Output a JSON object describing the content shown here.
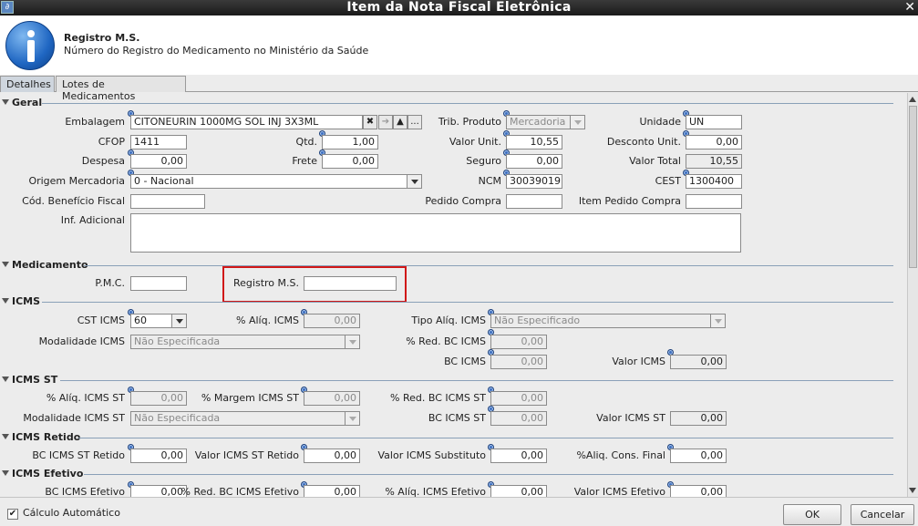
{
  "window": {
    "title": "Item da Nota Fiscal Eletrônica",
    "close_glyph": "✕",
    "app_icon_glyph": "∂"
  },
  "header": {
    "title": "Registro M.S.",
    "subtitle": "Número do Registro do Medicamento no Ministério da Saúde"
  },
  "tabs": [
    {
      "label": "Detalhes",
      "active": true
    },
    {
      "label": "Lotes de Medicamentos",
      "active": false
    }
  ],
  "geral": {
    "label": "Geral",
    "embalagem": {
      "label": "Embalagem",
      "value": "CITONEURIN 1000MG SOL INJ 3X3ML"
    },
    "trib_produto": {
      "label": "Trib. Produto",
      "value": "Mercadoria"
    },
    "unidade": {
      "label": "Unidade",
      "value": "UN"
    },
    "cfop": {
      "label": "CFOP",
      "value": "1411"
    },
    "qtd": {
      "label": "Qtd.",
      "value": "1,00"
    },
    "valor_unit": {
      "label": "Valor Unit.",
      "value": "10,55"
    },
    "desconto_unit": {
      "label": "Desconto Unit.",
      "value": "0,00"
    },
    "despesa": {
      "label": "Despesa",
      "value": "0,00"
    },
    "frete": {
      "label": "Frete",
      "value": "0,00"
    },
    "seguro": {
      "label": "Seguro",
      "value": "0,00"
    },
    "valor_total": {
      "label": "Valor Total",
      "value": "10,55"
    },
    "origem": {
      "label": "Origem Mercadoria",
      "value": "0 - Nacional"
    },
    "ncm": {
      "label": "NCM",
      "value": "30039019"
    },
    "cest": {
      "label": "CEST",
      "value": "1300400"
    },
    "cod_beneficio": {
      "label": "Cód. Benefício Fiscal",
      "value": ""
    },
    "pedido_compra": {
      "label": "Pedido Compra",
      "value": ""
    },
    "item_pedido": {
      "label": "Item Pedido Compra",
      "value": ""
    },
    "inf_adicional": {
      "label": "Inf. Adicional",
      "value": ""
    }
  },
  "medicamento": {
    "label": "Medicamento",
    "pmc": {
      "label": "P.M.C.",
      "value": ""
    },
    "registro_ms": {
      "label": "Registro M.S.",
      "value": ""
    }
  },
  "icms": {
    "label": "ICMS",
    "cst": {
      "label": "CST ICMS",
      "value": "60"
    },
    "aliq": {
      "label": "% Alíq. ICMS",
      "value": "0,00"
    },
    "tipo_aliq": {
      "label": "Tipo Alíq. ICMS",
      "value": "Não Especificado"
    },
    "modalidade": {
      "label": "Modalidade ICMS",
      "value": "Não Especificada"
    },
    "red_bc": {
      "label": "% Red. BC ICMS",
      "value": "0,00"
    },
    "bc": {
      "label": "BC ICMS",
      "value": "0,00"
    },
    "valor": {
      "label": "Valor ICMS",
      "value": "0,00"
    }
  },
  "icms_st": {
    "label": "ICMS ST",
    "aliq": {
      "label": "% Alíq. ICMS ST",
      "value": "0,00"
    },
    "margem": {
      "label": "% Margem ICMS ST",
      "value": "0,00"
    },
    "red_bc": {
      "label": "% Red. BC ICMS ST",
      "value": "0,00"
    },
    "modalidade": {
      "label": "Modalidade ICMS ST",
      "value": "Não Especificada"
    },
    "bc": {
      "label": "BC ICMS ST",
      "value": "0,00"
    },
    "valor": {
      "label": "Valor ICMS ST",
      "value": "0,00"
    }
  },
  "icms_retido": {
    "label": "ICMS Retido",
    "bc_st_retido": {
      "label": "BC ICMS ST Retido",
      "value": "0,00"
    },
    "valor_st_retido": {
      "label": "Valor ICMS ST Retido",
      "value": "0,00"
    },
    "valor_substituto": {
      "label": "Valor ICMS Substituto",
      "value": "0,00"
    },
    "aliq_cons_final": {
      "label": "%Aliq. Cons. Final",
      "value": "0,00"
    }
  },
  "icms_efetivo": {
    "label": "ICMS Efetivo",
    "bc": {
      "label": "BC ICMS Efetivo",
      "value": "0,00"
    },
    "red_bc": {
      "label": "% Red. BC ICMS Efetivo",
      "value": "0,00"
    },
    "aliq": {
      "label": "% Alíq. ICMS Efetivo",
      "value": "0,00"
    },
    "valor": {
      "label": "Valor ICMS Efetivo",
      "value": "0,00"
    }
  },
  "footer": {
    "calculo_label": "Cálculo Automático",
    "calculo_checked": true,
    "check_glyph": "✔",
    "ok_label": "OK",
    "cancel_label": "Cancelar"
  },
  "icons": {
    "clear_glyph": "✖",
    "arrow_right_glyph": "➔",
    "up_glyph": "▲",
    "ellipsis_glyph": "..."
  },
  "colors": {
    "highlight": "#d01818",
    "info_icon": "#1f66c2",
    "section_line": "#8aa0b8"
  }
}
